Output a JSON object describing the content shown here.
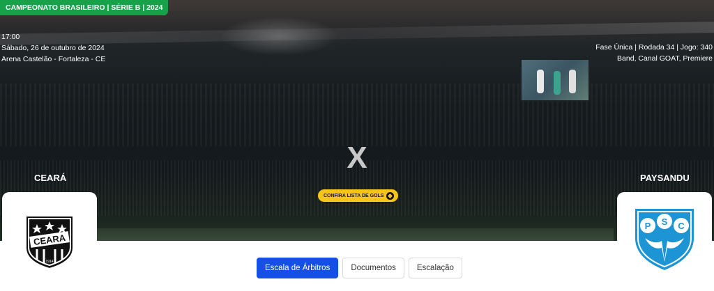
{
  "league_badge": "CAMPEONATO BRASILEIRO | SÉRIE B | 2024",
  "match": {
    "time": "17:00",
    "date": "Sábado, 26 de outubro de 2024",
    "venue": "Arena Castelão - Fortaleza - CE",
    "phase": "Fase Única | Rodada 34 | Jogo: 340",
    "broadcast": "Band, Canal GOAT, Premiere",
    "versus": "X"
  },
  "goals_button": {
    "label": "CONFIRA LISTA DE GOLS",
    "icon": "soccer-ball-icon"
  },
  "home_team": {
    "name": "CEARÁ",
    "crest_text": "CEARA",
    "crest_year": "1914"
  },
  "away_team": {
    "name": "PAYSANDU",
    "crest_letters": [
      "P",
      "S",
      "C"
    ]
  },
  "tabs": [
    {
      "label": "Escala de Árbitros",
      "active": true
    },
    {
      "label": "Documentos",
      "active": false
    },
    {
      "label": "Escalação",
      "active": false
    }
  ],
  "colors": {
    "league_green": "#17a24a",
    "accent_blue": "#1450e6",
    "goals_yellow": "#f5c51b",
    "paysandu_blue": "#1d95d4"
  }
}
